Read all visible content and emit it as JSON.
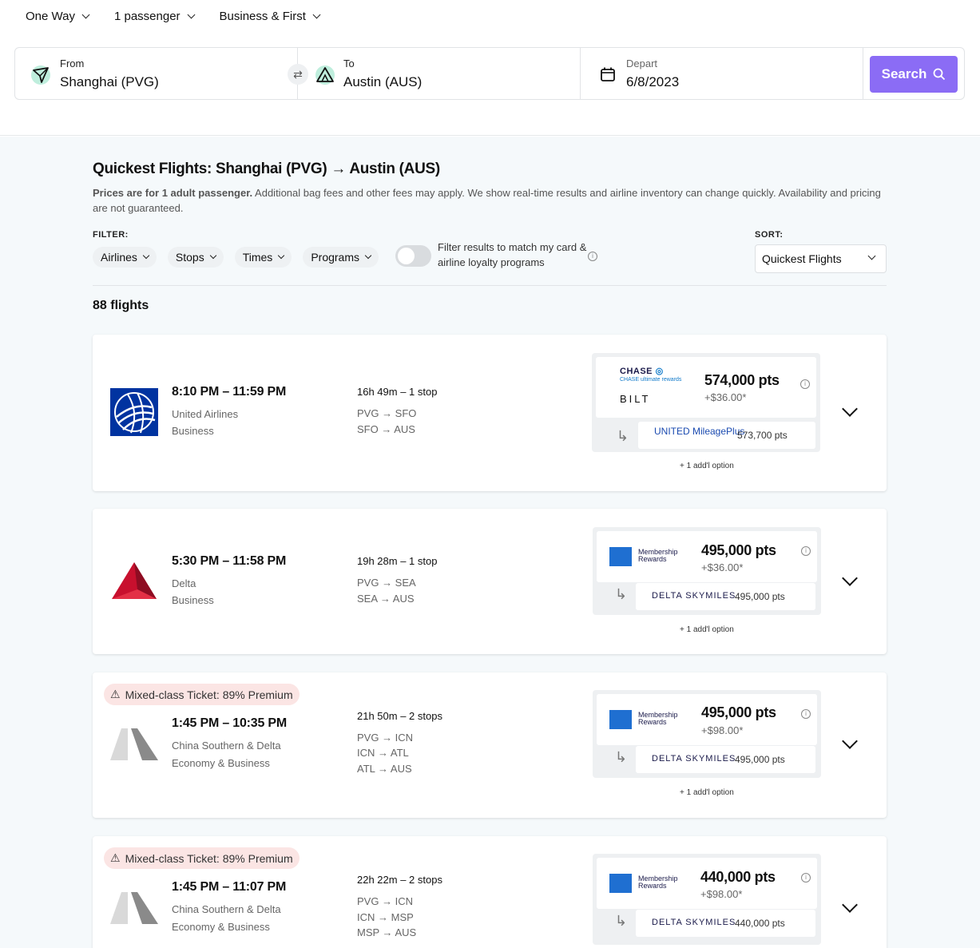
{
  "options": {
    "trip_type": "One Way",
    "passengers": "1 passenger",
    "cabin": "Business & First"
  },
  "search": {
    "from_label": "From",
    "from_value": "Shanghai (PVG)",
    "to_label": "To",
    "to_value": "Austin (AUS)",
    "depart_label": "Depart",
    "depart_value": "6/8/2023",
    "button": "Search"
  },
  "results": {
    "title": "Quickest Flights: Shanghai (PVG) → Austin (AUS)",
    "note_bold": "Prices are for 1 adult passenger.",
    "note_rest": " Additional bag fees and other fees may apply. We show real-time results and airline inventory can change quickly. Availability and pricing are not guaranteed.",
    "filter_label": "FILTER:",
    "filters": [
      "Airlines",
      "Stops",
      "Times",
      "Programs"
    ],
    "toggle_text": "Filter results to match my card & airline loyalty programs",
    "sort_label": "SORT:",
    "sort_value": "Quickest Flights",
    "count": "88 flights"
  },
  "flights": [
    {
      "time": "8:10 PM – 11:59 PM",
      "airline": "United Airlines",
      "cabin": "Business",
      "duration": "16h 49m – 1 stop",
      "legs": [
        "PVG → SFO",
        "SFO → AUS"
      ],
      "card_programs": [
        "CHASE ultimate rewards",
        "BILT"
      ],
      "points": "574,000 pts",
      "fee": "+$36.00*",
      "transfer_program": "UNITED MileagePlus",
      "transfer_points": "573,700 pts",
      "addl": "+ 1 add'l option"
    },
    {
      "time": "5:30 PM – 11:58 PM",
      "airline": "Delta",
      "cabin": "Business",
      "duration": "19h 28m – 1 stop",
      "legs": [
        "PVG → SEA",
        "SEA → AUS"
      ],
      "card_programs": [
        "Membership Rewards"
      ],
      "points": "495,000 pts",
      "fee": "+$36.00*",
      "transfer_program": "DELTA SKYMILES",
      "transfer_points": "495,000 pts",
      "addl": "+ 1 add'l option"
    },
    {
      "mixed": "Mixed-class Ticket: 89% Premium",
      "time": "1:45 PM – 10:35 PM",
      "airline": "China Southern & Delta",
      "cabin": "Economy & Business",
      "duration": "21h 50m – 2 stops",
      "legs": [
        "PVG → ICN",
        "ICN → ATL",
        "ATL → AUS"
      ],
      "card_programs": [
        "Membership Rewards"
      ],
      "points": "495,000 pts",
      "fee": "+$98.00*",
      "transfer_program": "DELTA SKYMILES",
      "transfer_points": "495,000 pts",
      "addl": "+ 1 add'l option"
    },
    {
      "mixed": "Mixed-class Ticket: 89% Premium",
      "time": "1:45 PM – 11:07 PM",
      "airline": "China Southern & Delta",
      "cabin": "Economy & Business",
      "duration": "22h 22m – 2 stops",
      "legs": [
        "PVG → ICN",
        "ICN → MSP",
        "MSP → AUS"
      ],
      "card_programs": [
        "Membership Rewards"
      ],
      "points": "440,000 pts",
      "fee": "+$98.00*",
      "transfer_program": "DELTA SKYMILES",
      "transfer_points": "440,000 pts"
    }
  ],
  "colors": {
    "accent": "#8b6cf5",
    "mixed_bg": "#fbe5e4",
    "united": "#0033a0",
    "delta": "#c8102e",
    "amex": "#1f6fd1"
  }
}
